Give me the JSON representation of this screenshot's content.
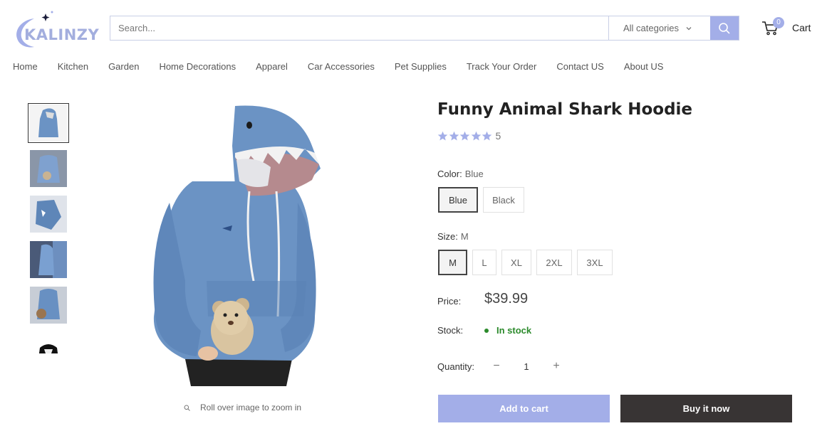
{
  "brand": {
    "name": "KALINZY"
  },
  "search": {
    "placeholder": "Search...",
    "category": "All categories"
  },
  "cart": {
    "label": "Cart",
    "count": "0"
  },
  "nav": [
    "Home",
    "Kitchen",
    "Garden",
    "Home Decorations",
    "Apparel",
    "Car Accessories",
    "Pet Supplies",
    "Track Your Order",
    "Contact US",
    "About US"
  ],
  "gallery": {
    "zoom_hint": "Roll over image to zoom in",
    "thumbnail_count": 6,
    "active_index": 0
  },
  "product": {
    "title": "Funny Animal Shark Hoodie",
    "rating": 5,
    "rating_count": "5",
    "color_label": "Color:",
    "color_value": "Blue",
    "colors": [
      "Blue",
      "Black"
    ],
    "size_label": "Size:",
    "size_value": "M",
    "sizes": [
      "M",
      "L",
      "XL",
      "2XL",
      "3XL"
    ],
    "price_label": "Price:",
    "price": "$39.99",
    "stock_label": "Stock:",
    "stock": "In stock",
    "quantity_label": "Quantity:",
    "quantity": "1",
    "minus": "−",
    "plus": "+",
    "add_to_cart": "Add to cart",
    "buy_now": "Buy it now"
  },
  "colors": {
    "accent": "#a3aee8",
    "dark_button": "#383434",
    "in_stock": "#2b8a2b",
    "hoodie": "#6b93c4"
  }
}
